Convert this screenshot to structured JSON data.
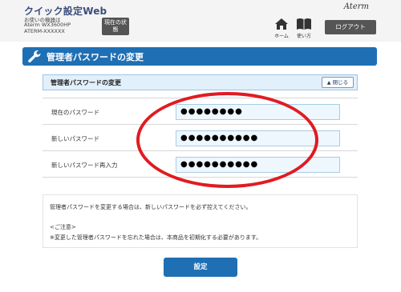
{
  "header": {
    "app_title": "クイック設定Web",
    "device_label": "お使いの機器は",
    "device_model": "Aterm WX3600HP",
    "device_name": "ATERM-XXXXXX",
    "status_button": "現在の状態",
    "brand": "Aterm",
    "home_label": "ホーム",
    "help_label": "使い方",
    "logout_button": "ログアウト",
    "icons": {
      "home": "home-icon",
      "help": "book-icon"
    }
  },
  "page": {
    "title": "管理者パスワードの変更",
    "title_icon": "wrench-icon"
  },
  "section": {
    "title": "管理者パスワードの変更",
    "collapse_button": "閉じる",
    "collapse_icon": "chevron-up-icon"
  },
  "form": {
    "rows": [
      {
        "label": "現在のパスワード",
        "value": "●●●●●●●●"
      },
      {
        "label": "新しいパスワード",
        "value": "●●●●●●●●●●"
      },
      {
        "label": "新しいパスワード再入力",
        "value": "●●●●●●●●●●"
      }
    ]
  },
  "note": {
    "line1": "管理者パスワードを変更する場合は、新しいパスワードを必ず控えてください。",
    "line2": "<ご注意>",
    "line3": "※変更した管理者パスワードを忘れた場合は、本商品を初期化する必要があります。"
  },
  "submit_button": "設定",
  "colors": {
    "accent": "#1f6fb4",
    "header_bg": "#f4f4f4",
    "annotation": "#e11b22",
    "dark_button": "#555555"
  }
}
